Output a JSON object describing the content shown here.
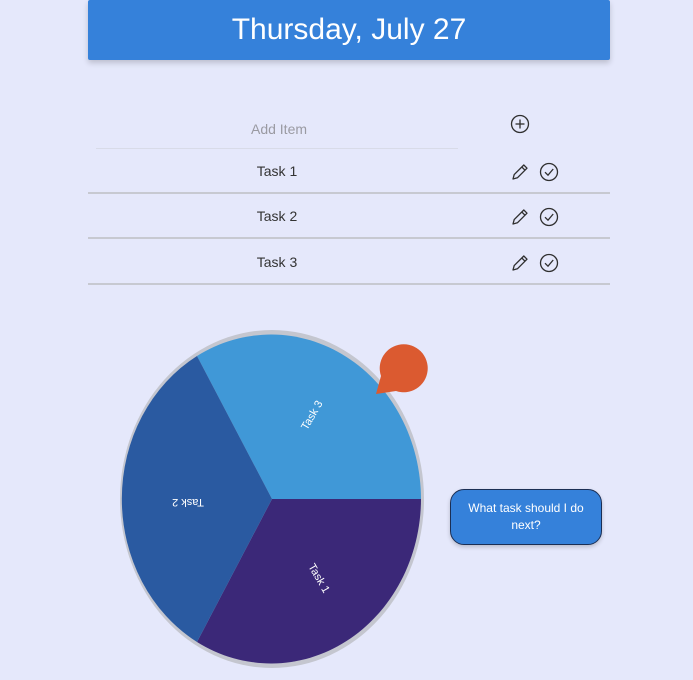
{
  "header": {
    "title": "Thursday, July 27"
  },
  "add_item": {
    "placeholder": "Add Item",
    "value": ""
  },
  "tasks": [
    {
      "label": "Task 1"
    },
    {
      "label": "Task 2"
    },
    {
      "label": "Task 3"
    }
  ],
  "wheel": {
    "segments": [
      {
        "label": "Task 3",
        "color": "#4098d7"
      },
      {
        "label": "Task 1",
        "color": "#3b2878"
      },
      {
        "label": "Task 2",
        "color": "#2a5aa1"
      }
    ],
    "rim_color": "#c4c6cf",
    "pointer_color": "#db5a30"
  },
  "spin_button": {
    "label": "What task should I do next?"
  },
  "icons": {
    "add": "plus-circle-icon",
    "edit": "pencil-icon",
    "complete": "check-circle-icon",
    "pointer": "teardrop-pointer-icon"
  }
}
